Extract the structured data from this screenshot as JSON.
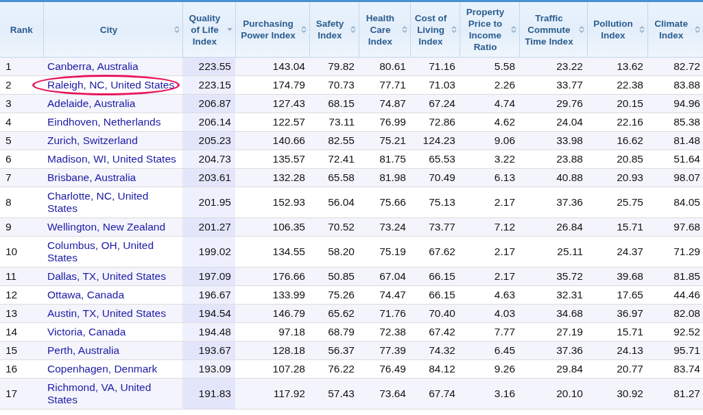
{
  "table": {
    "columns": [
      {
        "label": "Rank",
        "sortable": false
      },
      {
        "label": "City",
        "sortable": true,
        "sorted": false
      },
      {
        "label": "Quality of Life Index",
        "sortable": true,
        "sorted": true
      },
      {
        "label": "Purchasing Power Index",
        "sortable": true,
        "sorted": false
      },
      {
        "label": "Safety Index",
        "sortable": true,
        "sorted": false
      },
      {
        "label": "Health Care Index",
        "sortable": true,
        "sorted": false
      },
      {
        "label": "Cost of Living Index",
        "sortable": true,
        "sorted": false
      },
      {
        "label": "Property Price to Income Ratio",
        "sortable": true,
        "sorted": false
      },
      {
        "label": "Traffic Commute Time Index",
        "sortable": true,
        "sorted": false
      },
      {
        "label": "Pollution Index",
        "sortable": true,
        "sorted": false
      },
      {
        "label": "Climate Index",
        "sortable": true,
        "sorted": false
      }
    ],
    "rows": [
      {
        "rank": "1",
        "city": "Canberra, Australia",
        "circled": false,
        "values": [
          "223.55",
          "143.04",
          "79.82",
          "80.61",
          "71.16",
          "5.58",
          "23.22",
          "13.62",
          "82.72"
        ]
      },
      {
        "rank": "2",
        "city": "Raleigh, NC, United States",
        "circled": true,
        "values": [
          "223.15",
          "174.79",
          "70.73",
          "77.71",
          "71.03",
          "2.26",
          "33.77",
          "22.38",
          "83.88"
        ]
      },
      {
        "rank": "3",
        "city": "Adelaide, Australia",
        "circled": false,
        "values": [
          "206.87",
          "127.43",
          "68.15",
          "74.87",
          "67.24",
          "4.74",
          "29.76",
          "20.15",
          "94.96"
        ]
      },
      {
        "rank": "4",
        "city": "Eindhoven, Netherlands",
        "circled": false,
        "values": [
          "206.14",
          "122.57",
          "73.11",
          "76.99",
          "72.86",
          "4.62",
          "24.04",
          "22.16",
          "85.38"
        ]
      },
      {
        "rank": "5",
        "city": "Zurich, Switzerland",
        "circled": false,
        "values": [
          "205.23",
          "140.66",
          "82.55",
          "75.21",
          "124.23",
          "9.06",
          "33.98",
          "16.62",
          "81.48"
        ]
      },
      {
        "rank": "6",
        "city": "Madison, WI, United States",
        "circled": false,
        "values": [
          "204.73",
          "135.57",
          "72.41",
          "81.75",
          "65.53",
          "3.22",
          "23.88",
          "20.85",
          "51.64"
        ]
      },
      {
        "rank": "7",
        "city": "Brisbane, Australia",
        "circled": false,
        "values": [
          "203.61",
          "132.28",
          "65.58",
          "81.98",
          "70.49",
          "6.13",
          "40.88",
          "20.93",
          "98.07"
        ]
      },
      {
        "rank": "8",
        "city": "Charlotte, NC, United States",
        "circled": false,
        "values": [
          "201.95",
          "152.93",
          "56.04",
          "75.66",
          "75.13",
          "2.17",
          "37.36",
          "25.75",
          "84.05"
        ]
      },
      {
        "rank": "9",
        "city": "Wellington, New Zealand",
        "circled": false,
        "values": [
          "201.27",
          "106.35",
          "70.52",
          "73.24",
          "73.77",
          "7.12",
          "26.84",
          "15.71",
          "97.68"
        ]
      },
      {
        "rank": "10",
        "city": "Columbus, OH, United States",
        "circled": false,
        "values": [
          "199.02",
          "134.55",
          "58.20",
          "75.19",
          "67.62",
          "2.17",
          "25.11",
          "24.37",
          "71.29"
        ]
      },
      {
        "rank": "11",
        "city": "Dallas, TX, United States",
        "circled": false,
        "values": [
          "197.09",
          "176.66",
          "50.85",
          "67.04",
          "66.15",
          "2.17",
          "35.72",
          "39.68",
          "81.85"
        ]
      },
      {
        "rank": "12",
        "city": "Ottawa, Canada",
        "circled": false,
        "values": [
          "196.67",
          "133.99",
          "75.26",
          "74.47",
          "66.15",
          "4.63",
          "32.31",
          "17.65",
          "44.46"
        ]
      },
      {
        "rank": "13",
        "city": "Austin, TX, United States",
        "circled": false,
        "values": [
          "194.54",
          "146.79",
          "65.62",
          "71.76",
          "70.40",
          "4.03",
          "34.68",
          "36.97",
          "82.08"
        ]
      },
      {
        "rank": "14",
        "city": "Victoria, Canada",
        "circled": false,
        "values": [
          "194.48",
          "97.18",
          "68.79",
          "72.38",
          "67.42",
          "7.77",
          "27.19",
          "15.71",
          "92.52"
        ]
      },
      {
        "rank": "15",
        "city": "Perth, Australia",
        "circled": false,
        "values": [
          "193.67",
          "128.18",
          "56.37",
          "77.39",
          "74.32",
          "6.45",
          "37.36",
          "24.13",
          "95.71"
        ]
      },
      {
        "rank": "16",
        "city": "Copenhagen, Denmark",
        "circled": false,
        "values": [
          "193.09",
          "107.28",
          "76.22",
          "76.49",
          "84.12",
          "9.26",
          "29.84",
          "20.77",
          "83.74"
        ]
      },
      {
        "rank": "17",
        "city": "Richmond, VA, United States",
        "circled": false,
        "values": [
          "191.83",
          "117.92",
          "57.43",
          "73.64",
          "67.74",
          "3.16",
          "20.10",
          "30.92",
          "81.27"
        ]
      }
    ]
  }
}
